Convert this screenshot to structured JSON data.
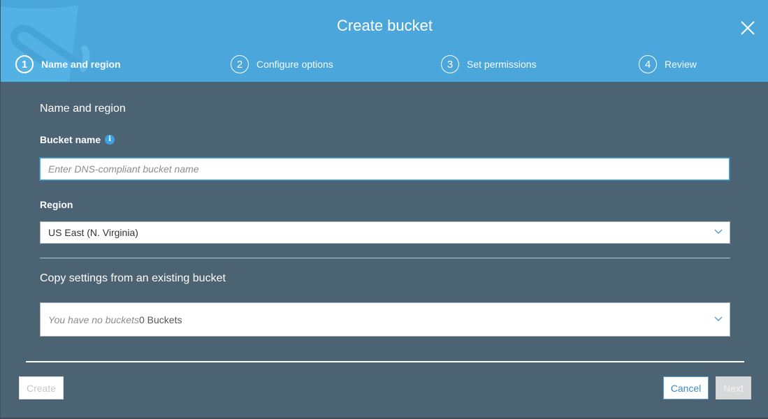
{
  "dialog": {
    "title": "Create bucket",
    "close_icon": "close-icon"
  },
  "steps": [
    {
      "number": "1",
      "label": "Name and region",
      "active": true
    },
    {
      "number": "2",
      "label": "Configure options",
      "active": false
    },
    {
      "number": "3",
      "label": "Set permissions",
      "active": false
    },
    {
      "number": "4",
      "label": "Review",
      "active": false
    }
  ],
  "form": {
    "section_title": "Name and region",
    "bucket_name": {
      "label": "Bucket name",
      "info_icon": "info-icon",
      "value": "",
      "placeholder": "Enter DNS-compliant bucket name"
    },
    "region": {
      "label": "Region",
      "selected": "US East (N. Virginia)"
    },
    "copy_settings": {
      "title": "Copy settings from an existing bucket",
      "placeholder": "You have no buckets",
      "count": "0 Buckets"
    }
  },
  "footer": {
    "create_label": "Create",
    "cancel_label": "Cancel",
    "next_label": "Next"
  },
  "colors": {
    "header": "#4ba7db",
    "body": "#4c6373",
    "accent": "#3e8ac4"
  }
}
